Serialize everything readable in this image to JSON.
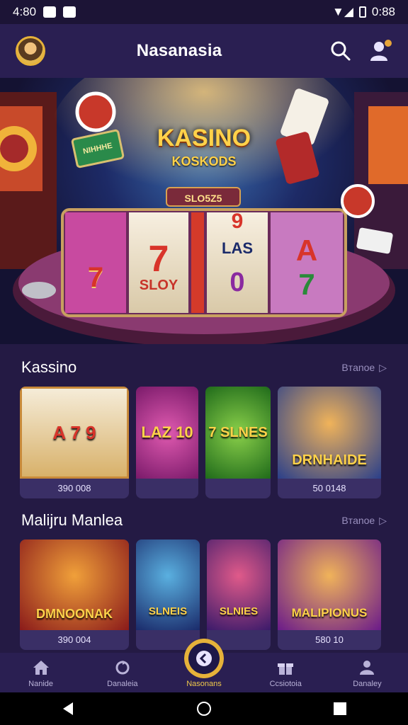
{
  "status_bar": {
    "time": "4:80",
    "battery_time": "0:88"
  },
  "header": {
    "title": "Nasanasia",
    "search_icon": "search-icon",
    "profile_icon": "user-icon"
  },
  "banner": {
    "logo_title": "KASINO",
    "logo_subtitle": "KOSKODS",
    "sign_text": "NIHHHE",
    "reel_plate": "SLO5Z5",
    "reel_symbols": [
      "7",
      "7",
      "SLOY",
      "9",
      "LAS",
      "0",
      "A",
      "7"
    ]
  },
  "sections": [
    {
      "title": "Kassino",
      "more_label": "Bтanoe",
      "cards": [
        {
          "art_text": "A 7 9",
          "caption": "390 008",
          "accent": "#d8b16a"
        },
        {
          "art_text": "LAZ 10",
          "caption": "",
          "accent": "#b3309a"
        },
        {
          "art_text": "7 SLNES",
          "caption": "",
          "accent": "#3fa63a"
        },
        {
          "art_text": "DRNHAIDE",
          "caption": "50 0148",
          "accent": "#2a5fb5"
        }
      ]
    },
    {
      "title": "Malijru Manlea",
      "more_label": "Bтanoe",
      "cards": [
        {
          "art_text": "DMNOONAK",
          "caption": "390 004",
          "accent": "#c0322a"
        },
        {
          "art_text": "SLNEIS",
          "caption": "",
          "accent": "#2a6fc0"
        },
        {
          "art_text": "SLNIES",
          "caption": "",
          "accent": "#7a2a9a"
        },
        {
          "art_text": "MALIPIONUS",
          "caption": "580 10",
          "accent": "#8a2aa0"
        }
      ]
    }
  ],
  "bottom_nav": [
    {
      "label": "Nanide",
      "icon": "home-icon"
    },
    {
      "label": "Danaleia",
      "icon": "refresh-icon"
    },
    {
      "label": "Nasonans",
      "icon": "play-icon"
    },
    {
      "label": "Ccsiotoia",
      "icon": "gift-icon"
    },
    {
      "label": "Danaley",
      "icon": "person-icon"
    }
  ]
}
